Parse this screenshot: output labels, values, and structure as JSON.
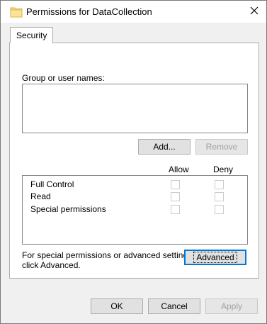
{
  "window": {
    "title": "Permissions for DataCollection"
  },
  "tabs": [
    {
      "label": "Security"
    }
  ],
  "security": {
    "group_label": "Group or user names:",
    "add_button": "Add...",
    "remove_button": "Remove",
    "allow_header": "Allow",
    "deny_header": "Deny",
    "permissions": [
      {
        "name": "Full Control",
        "allow": false,
        "deny": false
      },
      {
        "name": "Read",
        "allow": false,
        "deny": false
      },
      {
        "name": "Special permissions",
        "allow": false,
        "deny": false
      }
    ],
    "advanced_text_line1": "For special permissions or advanced settings,",
    "advanced_text_line2": "click Advanced.",
    "advanced_button": "Advanced"
  },
  "footer": {
    "ok_button": "OK",
    "cancel_button": "Cancel",
    "apply_button": "Apply"
  },
  "icons": {
    "folder": "folder-icon",
    "close": "close-icon"
  },
  "colors": {
    "dialog_bg": "#f0f0f0",
    "focus_blue": "#0078d7",
    "folder_yellow": "#f8d775"
  }
}
